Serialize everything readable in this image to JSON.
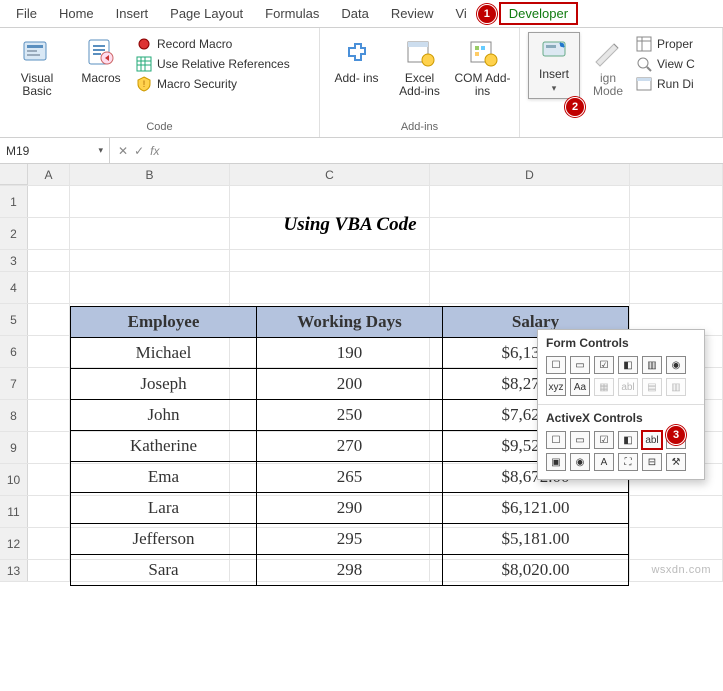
{
  "tabs": [
    "File",
    "Home",
    "Insert",
    "Page Layout",
    "Formulas",
    "Data",
    "Review",
    "Vi",
    "Developer"
  ],
  "ribbon": {
    "code": {
      "label": "Code",
      "visual_basic": "Visual\nBasic",
      "macros": "Macros",
      "record_macro": "Record Macro",
      "use_relative": "Use Relative References",
      "macro_security": "Macro Security"
    },
    "addins": {
      "label": "Add-ins",
      "addins": "Add-\nins",
      "excel_addins": "Excel\nAdd-ins",
      "com_addins": "COM\nAdd-ins"
    },
    "controls": {
      "insert": "Insert",
      "design_mode": "ign\nMode",
      "properties": "Proper",
      "view_code": "View C",
      "run_dialog": "Run Di"
    }
  },
  "callouts": {
    "c1": "1",
    "c2": "2",
    "c3": "3"
  },
  "fx": {
    "name": "M19",
    "fx_symbol": "fx"
  },
  "columns": [
    "A",
    "B",
    "C",
    "D"
  ],
  "rows": [
    "1",
    "2",
    "3",
    "4",
    "5",
    "6",
    "7",
    "8",
    "9",
    "10",
    "11",
    "12",
    "13"
  ],
  "sheet_title": "Using VBA Code",
  "table": {
    "headers": [
      "Employee",
      "Working Days",
      "Salary"
    ],
    "rows": [
      [
        "Michael",
        "190",
        "$6,136.00"
      ],
      [
        "Joseph",
        "200",
        "$8,275.00"
      ],
      [
        "John",
        "250",
        "$7,625.00"
      ],
      [
        "Katherine",
        "270",
        "$9,523.00"
      ],
      [
        "Ema",
        "265",
        "$8,672.00"
      ],
      [
        "Lara",
        "290",
        "$6,121.00"
      ],
      [
        "Jefferson",
        "295",
        "$5,181.00"
      ],
      [
        "Sara",
        "298",
        "$8,020.00"
      ]
    ]
  },
  "dropdown": {
    "form_label": "Form Controls",
    "activex_label": "ActiveX Controls",
    "form_icons": [
      "☐",
      "▭",
      "☑",
      "◧",
      "▥",
      "◉",
      "xyz",
      "Aa",
      "▦",
      "abl",
      "▤",
      "▥"
    ],
    "activex_icons": [
      "☐",
      "▭",
      "☑",
      "◧",
      "abl",
      "⎙",
      "▣",
      "◉",
      "A",
      "⛶",
      "⊟",
      "⚒"
    ]
  },
  "watermark": "wsxdn.com",
  "chart_data": {
    "type": "table",
    "title": "Using VBA Code",
    "columns": [
      "Employee",
      "Working Days",
      "Salary"
    ],
    "rows": [
      {
        "Employee": "Michael",
        "Working Days": 190,
        "Salary": 6136.0
      },
      {
        "Employee": "Joseph",
        "Working Days": 200,
        "Salary": 8275.0
      },
      {
        "Employee": "John",
        "Working Days": 250,
        "Salary": 7625.0
      },
      {
        "Employee": "Katherine",
        "Working Days": 270,
        "Salary": 9523.0
      },
      {
        "Employee": "Ema",
        "Working Days": 265,
        "Salary": 8672.0
      },
      {
        "Employee": "Lara",
        "Working Days": 290,
        "Salary": 6121.0
      },
      {
        "Employee": "Jefferson",
        "Working Days": 295,
        "Salary": 5181.0
      },
      {
        "Employee": "Sara",
        "Working Days": 298,
        "Salary": 8020.0
      }
    ]
  }
}
